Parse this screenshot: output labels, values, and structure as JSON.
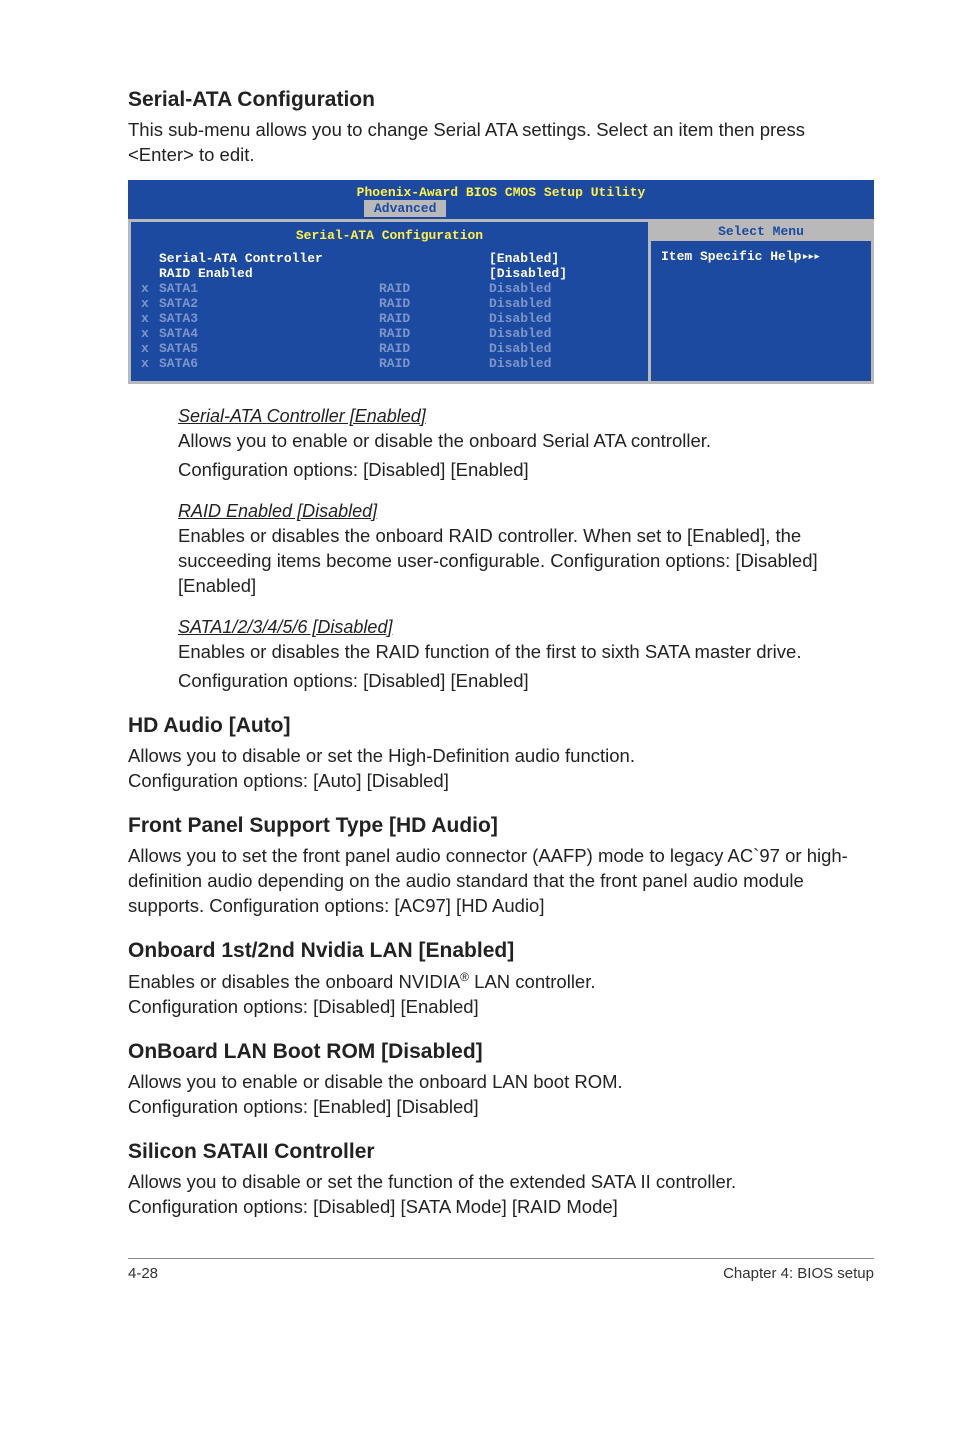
{
  "sections": {
    "serial_ata_config": {
      "heading": "Serial-ATA Configuration",
      "intro": "This sub-menu allows you to change Serial ATA settings. Select an item then press <Enter> to edit."
    },
    "hd_audio": {
      "heading": "HD Audio [Auto]",
      "text1": "Allows you to disable or set the High-Definition audio function.",
      "text2": "Configuration options: [Auto] [Disabled]"
    },
    "front_panel": {
      "heading": "Front Panel Support Type [HD Audio]",
      "text": "Allows you to set the front panel audio connector (AAFP) mode to legacy AC`97 or high-definition audio depending on the audio standard that the front panel audio module supports. Configuration options: [AC97] [HD Audio]"
    },
    "onboard_lan": {
      "heading": "Onboard 1st/2nd Nvidia LAN [Enabled]",
      "text1_pre": "Enables or disables the onboard NVIDIA",
      "text1_post": " LAN controller.",
      "text2": "Configuration options: [Disabled] [Enabled]"
    },
    "onboard_boot_rom": {
      "heading": "OnBoard LAN Boot ROM [Disabled]",
      "text1": "Allows you to enable or disable the onboard LAN boot ROM.",
      "text2": "Configuration options: [Enabled] [Disabled]"
    },
    "silicon": {
      "heading": "Silicon SATAII Controller",
      "text1": "Allows you to disable or set the function of the extended SATA II controller.",
      "text2": "Configuration options: [Disabled] [SATA Mode] [RAID Mode]"
    }
  },
  "sub_items": {
    "serial_ata_controller": {
      "title": "Serial-ATA Controller [Enabled]",
      "line1": "Allows you to enable or disable the onboard Serial ATA controller.",
      "line2": "Configuration options: [Disabled] [Enabled]"
    },
    "raid_enabled": {
      "title": "RAID Enabled [Disabled]",
      "line1": "Enables or disables the onboard RAID controller. When set to [Enabled], the succeeding items become user-configurable. Configuration options: [Disabled] [Enabled]"
    },
    "sata_disabled": {
      "title": "SATA1/2/3/4/5/6 [Disabled]",
      "line1": "Enables or disables the RAID function of the first to sixth SATA master drive.",
      "line2": "Configuration options: [Disabled] [Enabled]"
    }
  },
  "bios": {
    "title": "Phoenix-Award BIOS CMOS Setup Utility",
    "active_tab": "Advanced",
    "left_header": "Serial-ATA Configuration",
    "right_header": "Select Menu",
    "help_text": "Item Specific Help",
    "arrows": "▸▸▸",
    "rows": [
      {
        "x": "",
        "name": "Serial-ATA Controller",
        "mid": "",
        "val": "[Enabled]",
        "cls": "enabled-row"
      },
      {
        "x": "",
        "name": "RAID Enabled",
        "mid": "",
        "val": "[Disabled]",
        "cls": "enabled-row"
      },
      {
        "x": "x",
        "name": "SATA1",
        "mid": "RAID",
        "val": "Disabled",
        "cls": "dim-row"
      },
      {
        "x": "x",
        "name": "SATA2",
        "mid": "RAID",
        "val": "Disabled",
        "cls": "dim-row"
      },
      {
        "x": "x",
        "name": "SATA3",
        "mid": "RAID",
        "val": "Disabled",
        "cls": "dim-row"
      },
      {
        "x": "x",
        "name": "SATA4",
        "mid": "RAID",
        "val": "Disabled",
        "cls": "dim-row"
      },
      {
        "x": "x",
        "name": "SATA5",
        "mid": "RAID",
        "val": "Disabled",
        "cls": "dim-row"
      },
      {
        "x": "x",
        "name": "SATA6",
        "mid": "RAID",
        "val": "Disabled",
        "cls": "dim-row"
      }
    ]
  },
  "footer": {
    "left": "4-28",
    "right": "Chapter 4: BIOS setup"
  }
}
